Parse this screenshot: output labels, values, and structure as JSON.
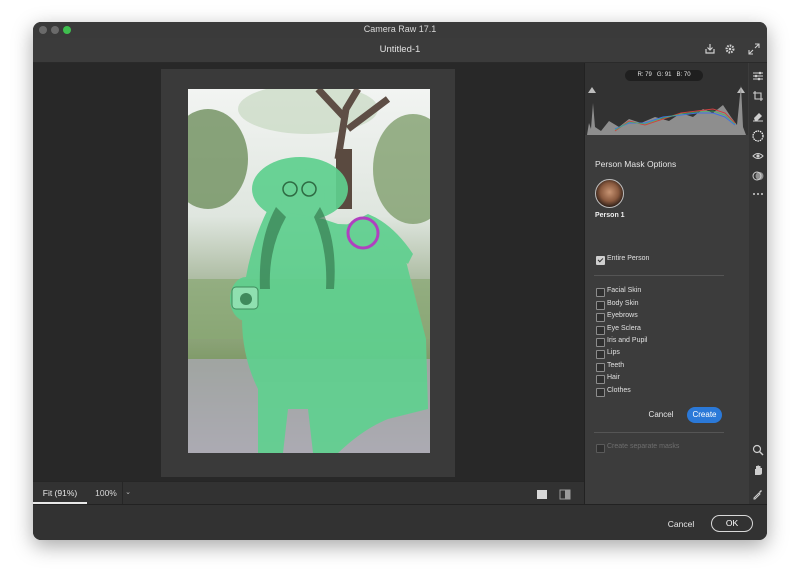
{
  "window": {
    "title": "Camera Raw 17.1"
  },
  "document": {
    "title": "Untitled-1"
  },
  "histogram": {
    "r_label": "R: 79",
    "g_label": "G: 91",
    "b_label": "B: 70"
  },
  "mask_options": {
    "title": "Person Mask Options",
    "person_label": "Person 1",
    "entire_person": {
      "label": "Entire Person",
      "checked": true
    },
    "parts": [
      {
        "label": "Facial Skin",
        "checked": false
      },
      {
        "label": "Body Skin",
        "checked": false
      },
      {
        "label": "Eyebrows",
        "checked": false
      },
      {
        "label": "Eye Sclera",
        "checked": false
      },
      {
        "label": "Iris and Pupil",
        "checked": false
      },
      {
        "label": "Lips",
        "checked": false
      },
      {
        "label": "Teeth",
        "checked": false
      },
      {
        "label": "Hair",
        "checked": false
      },
      {
        "label": "Clothes",
        "checked": false
      }
    ],
    "cancel_label": "Cancel",
    "create_label": "Create",
    "separate_masks_label": "Create separate masks"
  },
  "zoom": {
    "fit_label": "Fit (91%)",
    "level_label": "100%"
  },
  "footer": {
    "cancel_label": "Cancel",
    "ok_label": "OK"
  },
  "colors": {
    "accent": "#2b79d8",
    "mask_overlay": "#5fd08f",
    "traffic_green": "#3fbf4f"
  },
  "icons": [
    "save-icon",
    "gear-icon",
    "fullscreen-icon",
    "edit-sliders-icon",
    "crop-icon",
    "heal-eraser-icon",
    "masking-icon",
    "red-eye-icon",
    "presets-icon",
    "more-icon",
    "zoom-icon",
    "hand-icon",
    "eyedropper-icon",
    "grid-icon",
    "single-view-icon",
    "compare-view-icon"
  ]
}
